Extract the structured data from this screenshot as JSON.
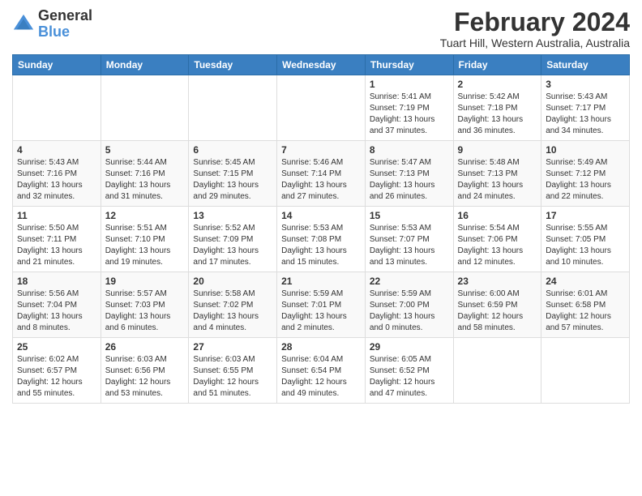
{
  "logo": {
    "general": "General",
    "blue": "Blue"
  },
  "header": {
    "month": "February 2024",
    "location": "Tuart Hill, Western Australia, Australia"
  },
  "weekdays": [
    "Sunday",
    "Monday",
    "Tuesday",
    "Wednesday",
    "Thursday",
    "Friday",
    "Saturday"
  ],
  "weeks": [
    [
      {
        "day": "",
        "info": ""
      },
      {
        "day": "",
        "info": ""
      },
      {
        "day": "",
        "info": ""
      },
      {
        "day": "",
        "info": ""
      },
      {
        "day": "1",
        "info": "Sunrise: 5:41 AM\nSunset: 7:19 PM\nDaylight: 13 hours\nand 37 minutes."
      },
      {
        "day": "2",
        "info": "Sunrise: 5:42 AM\nSunset: 7:18 PM\nDaylight: 13 hours\nand 36 minutes."
      },
      {
        "day": "3",
        "info": "Sunrise: 5:43 AM\nSunset: 7:17 PM\nDaylight: 13 hours\nand 34 minutes."
      }
    ],
    [
      {
        "day": "4",
        "info": "Sunrise: 5:43 AM\nSunset: 7:16 PM\nDaylight: 13 hours\nand 32 minutes."
      },
      {
        "day": "5",
        "info": "Sunrise: 5:44 AM\nSunset: 7:16 PM\nDaylight: 13 hours\nand 31 minutes."
      },
      {
        "day": "6",
        "info": "Sunrise: 5:45 AM\nSunset: 7:15 PM\nDaylight: 13 hours\nand 29 minutes."
      },
      {
        "day": "7",
        "info": "Sunrise: 5:46 AM\nSunset: 7:14 PM\nDaylight: 13 hours\nand 27 minutes."
      },
      {
        "day": "8",
        "info": "Sunrise: 5:47 AM\nSunset: 7:13 PM\nDaylight: 13 hours\nand 26 minutes."
      },
      {
        "day": "9",
        "info": "Sunrise: 5:48 AM\nSunset: 7:13 PM\nDaylight: 13 hours\nand 24 minutes."
      },
      {
        "day": "10",
        "info": "Sunrise: 5:49 AM\nSunset: 7:12 PM\nDaylight: 13 hours\nand 22 minutes."
      }
    ],
    [
      {
        "day": "11",
        "info": "Sunrise: 5:50 AM\nSunset: 7:11 PM\nDaylight: 13 hours\nand 21 minutes."
      },
      {
        "day": "12",
        "info": "Sunrise: 5:51 AM\nSunset: 7:10 PM\nDaylight: 13 hours\nand 19 minutes."
      },
      {
        "day": "13",
        "info": "Sunrise: 5:52 AM\nSunset: 7:09 PM\nDaylight: 13 hours\nand 17 minutes."
      },
      {
        "day": "14",
        "info": "Sunrise: 5:53 AM\nSunset: 7:08 PM\nDaylight: 13 hours\nand 15 minutes."
      },
      {
        "day": "15",
        "info": "Sunrise: 5:53 AM\nSunset: 7:07 PM\nDaylight: 13 hours\nand 13 minutes."
      },
      {
        "day": "16",
        "info": "Sunrise: 5:54 AM\nSunset: 7:06 PM\nDaylight: 13 hours\nand 12 minutes."
      },
      {
        "day": "17",
        "info": "Sunrise: 5:55 AM\nSunset: 7:05 PM\nDaylight: 13 hours\nand 10 minutes."
      }
    ],
    [
      {
        "day": "18",
        "info": "Sunrise: 5:56 AM\nSunset: 7:04 PM\nDaylight: 13 hours\nand 8 minutes."
      },
      {
        "day": "19",
        "info": "Sunrise: 5:57 AM\nSunset: 7:03 PM\nDaylight: 13 hours\nand 6 minutes."
      },
      {
        "day": "20",
        "info": "Sunrise: 5:58 AM\nSunset: 7:02 PM\nDaylight: 13 hours\nand 4 minutes."
      },
      {
        "day": "21",
        "info": "Sunrise: 5:59 AM\nSunset: 7:01 PM\nDaylight: 13 hours\nand 2 minutes."
      },
      {
        "day": "22",
        "info": "Sunrise: 5:59 AM\nSunset: 7:00 PM\nDaylight: 13 hours\nand 0 minutes."
      },
      {
        "day": "23",
        "info": "Sunrise: 6:00 AM\nSunset: 6:59 PM\nDaylight: 12 hours\nand 58 minutes."
      },
      {
        "day": "24",
        "info": "Sunrise: 6:01 AM\nSunset: 6:58 PM\nDaylight: 12 hours\nand 57 minutes."
      }
    ],
    [
      {
        "day": "25",
        "info": "Sunrise: 6:02 AM\nSunset: 6:57 PM\nDaylight: 12 hours\nand 55 minutes."
      },
      {
        "day": "26",
        "info": "Sunrise: 6:03 AM\nSunset: 6:56 PM\nDaylight: 12 hours\nand 53 minutes."
      },
      {
        "day": "27",
        "info": "Sunrise: 6:03 AM\nSunset: 6:55 PM\nDaylight: 12 hours\nand 51 minutes."
      },
      {
        "day": "28",
        "info": "Sunrise: 6:04 AM\nSunset: 6:54 PM\nDaylight: 12 hours\nand 49 minutes."
      },
      {
        "day": "29",
        "info": "Sunrise: 6:05 AM\nSunset: 6:52 PM\nDaylight: 12 hours\nand 47 minutes."
      },
      {
        "day": "",
        "info": ""
      },
      {
        "day": "",
        "info": ""
      }
    ]
  ]
}
